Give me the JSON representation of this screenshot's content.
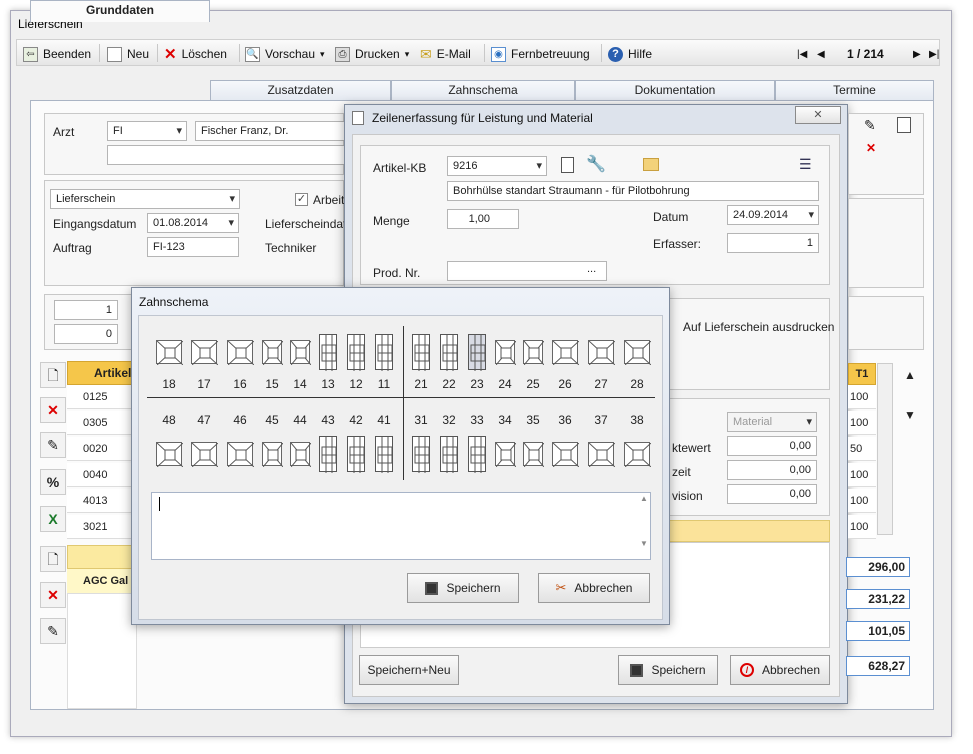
{
  "window": {
    "title": "Lieferschein"
  },
  "toolbar": {
    "beenden": "Beenden",
    "neu": "Neu",
    "loeschen": "Löschen",
    "vorschau": "Vorschau",
    "drucken": "Drucken",
    "email": "E-Mail",
    "fernbetreuung": "Fernbetreuung",
    "hilfe": "Hilfe",
    "record": "1 / 214"
  },
  "tabs": [
    "Grunddaten",
    "Zusatzdaten",
    "Zahnschema",
    "Dokumentation",
    "Termine"
  ],
  "main": {
    "arzt_label": "Arzt",
    "arzt_code": "FI",
    "arzt_name": "Fischer Franz, Dr.",
    "doctype": "Lieferschein",
    "arbeit_label": "Arbeit",
    "eingangsdatum_label": "Eingangsdatum",
    "eingangsdatum": "01.08.2014",
    "lieferscheindatum_label": "Lieferscheindat",
    "auftrag_label": "Auftrag",
    "auftrag": "FI-123",
    "techniker_label": "Techniker",
    "spin1": "1",
    "spin2": "0",
    "artikel_header": "Artikel",
    "t1_header": "T1",
    "rows": [
      "0125",
      "0305",
      "0020",
      "0040",
      "4013",
      "3021"
    ],
    "t1_values": [
      "100",
      "100",
      "50",
      "100",
      "100",
      "100"
    ],
    "agc": "AGC Gal",
    "sums": [
      "296,00",
      "231,22",
      "101,05",
      "628,27"
    ]
  },
  "zeilen": {
    "title": "Zeilenerfassung für Leistung und Material",
    "artikel_label": "Artikel-KB",
    "artikel_kb": "9216",
    "artikel_text": "Bohrhülse standart Straumann - für Pilotbohrung",
    "menge_label": "Menge",
    "menge": "1,00",
    "datum_label": "Datum",
    "datum": "24.09.2014",
    "erfasser_label": "Erfasser:",
    "erfasser": "1",
    "prodnr_label": "Prod. Nr.",
    "prodnr_btn": "...",
    "auf_lieferschein": "Auf Lieferschein ausdrucken",
    "material": "Material",
    "punktwert_label": "ktewert",
    "punktwert": "0,00",
    "zeit_label": "zeit",
    "zeit": "0,00",
    "provision_label": "vision",
    "provision": "0,00",
    "speichern_neu": "Speichern+Neu",
    "speichern": "Speichern",
    "abbrechen": "Abbrechen"
  },
  "zahnschema": {
    "title": "Zahnschema",
    "upper": [
      "18",
      "17",
      "16",
      "15",
      "14",
      "13",
      "12",
      "11",
      "21",
      "22",
      "23",
      "24",
      "25",
      "26",
      "27",
      "28"
    ],
    "lower": [
      "48",
      "47",
      "46",
      "45",
      "44",
      "43",
      "42",
      "41",
      "31",
      "32",
      "33",
      "34",
      "35",
      "36",
      "37",
      "38"
    ],
    "speichern": "Speichern",
    "abbrechen": "Abbrechen"
  }
}
